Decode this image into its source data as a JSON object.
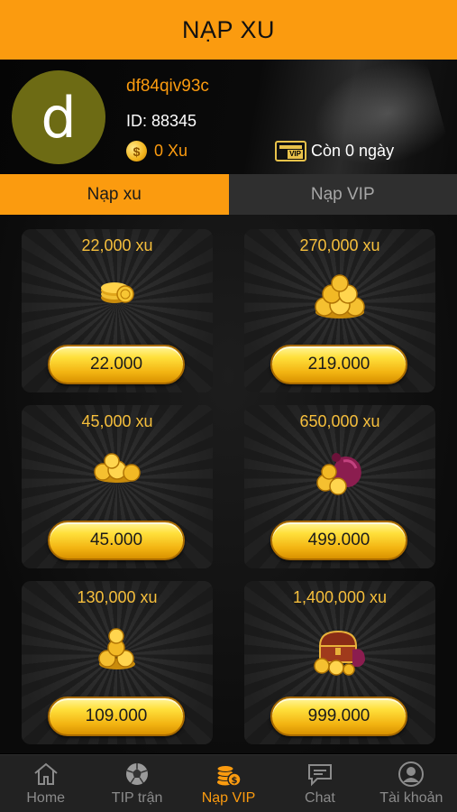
{
  "header": {
    "title": "NẠP XU"
  },
  "profile": {
    "avatar_letter": "d",
    "username": "df84qiv93c",
    "id_text": "ID: 88345",
    "balance": "0 Xu",
    "vip_badge": "VIP",
    "vip_status": "Còn 0 ngày"
  },
  "tabs": [
    {
      "label": "Nạp xu",
      "active": true
    },
    {
      "label": "Nạp VIP",
      "active": false
    }
  ],
  "packages": [
    {
      "title": "22,000 xu",
      "price": "22.000",
      "icon": "small-coin-stack-icon"
    },
    {
      "title": "270,000 xu",
      "price": "219.000",
      "icon": "large-coin-pile-icon"
    },
    {
      "title": "45,000 xu",
      "price": "45.000",
      "icon": "coin-pile-icon"
    },
    {
      "title": "650,000 xu",
      "price": "499.000",
      "icon": "coin-bag-icon"
    },
    {
      "title": "130,000 xu",
      "price": "109.000",
      "icon": "coin-tower-icon"
    },
    {
      "title": "1,400,000 xu",
      "price": "999.000",
      "icon": "treasure-chest-icon"
    }
  ],
  "nav": [
    {
      "label": "Home",
      "icon": "home-icon",
      "active": false
    },
    {
      "label": "TIP trận",
      "icon": "soccer-ball-icon",
      "active": false
    },
    {
      "label": "Nạp VIP",
      "icon": "coin-stack-icon",
      "active": true
    },
    {
      "label": "Chat",
      "icon": "chat-icon",
      "active": false
    },
    {
      "label": "Tài khoản",
      "icon": "user-icon",
      "active": false
    }
  ],
  "colors": {
    "accent": "#fb9b0f",
    "gold_text": "#f6bf3c",
    "nav_bg": "#222222"
  }
}
